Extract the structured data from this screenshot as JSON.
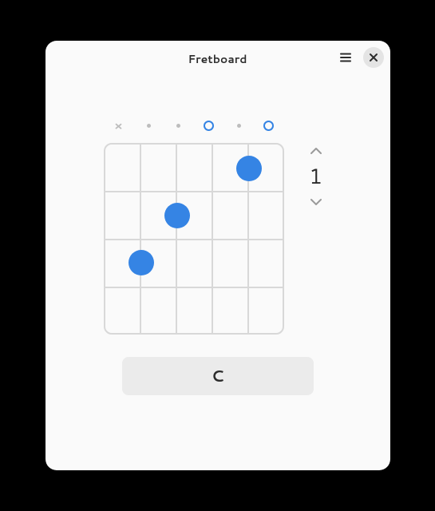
{
  "header": {
    "title": "Fretboard",
    "menu_icon": "hamburger-icon",
    "close_icon": "close-icon"
  },
  "strings": [
    {
      "state": "muted",
      "label": "×"
    },
    {
      "state": "inactive"
    },
    {
      "state": "inactive"
    },
    {
      "state": "open"
    },
    {
      "state": "inactive"
    },
    {
      "state": "open"
    }
  ],
  "fingers": [
    {
      "string": 5,
      "fret": 1
    },
    {
      "string": 3,
      "fret": 2
    },
    {
      "string": 2,
      "fret": 3
    }
  ],
  "position": {
    "value": "1",
    "up_icon": "chevron-up-icon",
    "down_icon": "chevron-down-icon"
  },
  "chord": {
    "name": "C"
  },
  "colors": {
    "accent": "#3584e4",
    "grid": "#d8d8d8",
    "muted": "#bdbdbd"
  }
}
